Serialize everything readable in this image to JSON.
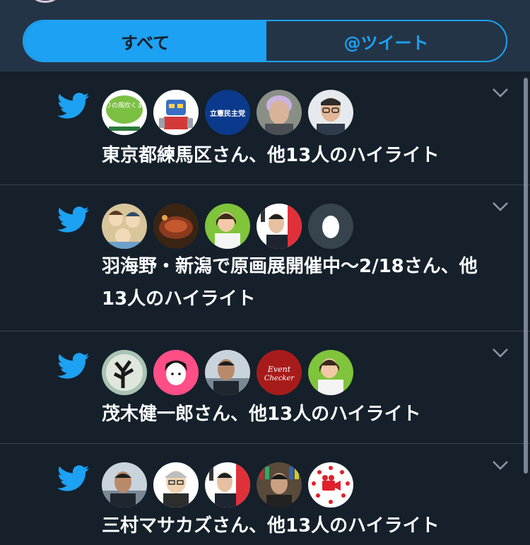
{
  "tabs": {
    "all_label": "すべて",
    "tweets_label": "@ツイート"
  },
  "colors": {
    "background": "#15202b",
    "header": "#243447",
    "accent": "#1da1f2",
    "divider": "#38444d",
    "chevron": "#8b98a5"
  },
  "items": [
    {
      "icon": "twitter-bird-icon",
      "text": "東京都練馬区さん、他13人のハイライト",
      "avatars": [
        "avatar-midori-kaze",
        "avatar-robot-figure",
        "avatar-cdp-logo",
        "avatar-elderly-man",
        "avatar-man-glasses"
      ],
      "avatar_texts": {
        "cdp": "立憲民主党",
        "midori": "みどりの風吹くまち〜"
      }
    },
    {
      "icon": "twitter-bird-icon",
      "text": "羽海野・新潟で原画展開催中〜2/18さん、他13人のハイライト",
      "avatars": [
        "avatar-manga-art",
        "avatar-steak-food",
        "avatar-woman-green",
        "avatar-book-cover-man",
        "avatar-default-egg"
      ]
    },
    {
      "icon": "twitter-bird-icon",
      "text": "茂木健一郎さん、他13人のハイライト",
      "avatars": [
        "avatar-dark-sculpture",
        "avatar-cartoon-girl",
        "avatar-man-office",
        "avatar-event-checker",
        "avatar-woman-green"
      ],
      "avatar_texts": {
        "event": "Event",
        "checker": "Checker"
      }
    },
    {
      "icon": "twitter-bird-icon",
      "text": "三村マサカズさん、他13人のハイライト",
      "avatars": [
        "avatar-man-office",
        "avatar-cartoon-old-man",
        "avatar-book-cover-man",
        "avatar-man-bookshelf",
        "avatar-camera-stars"
      ]
    }
  ]
}
